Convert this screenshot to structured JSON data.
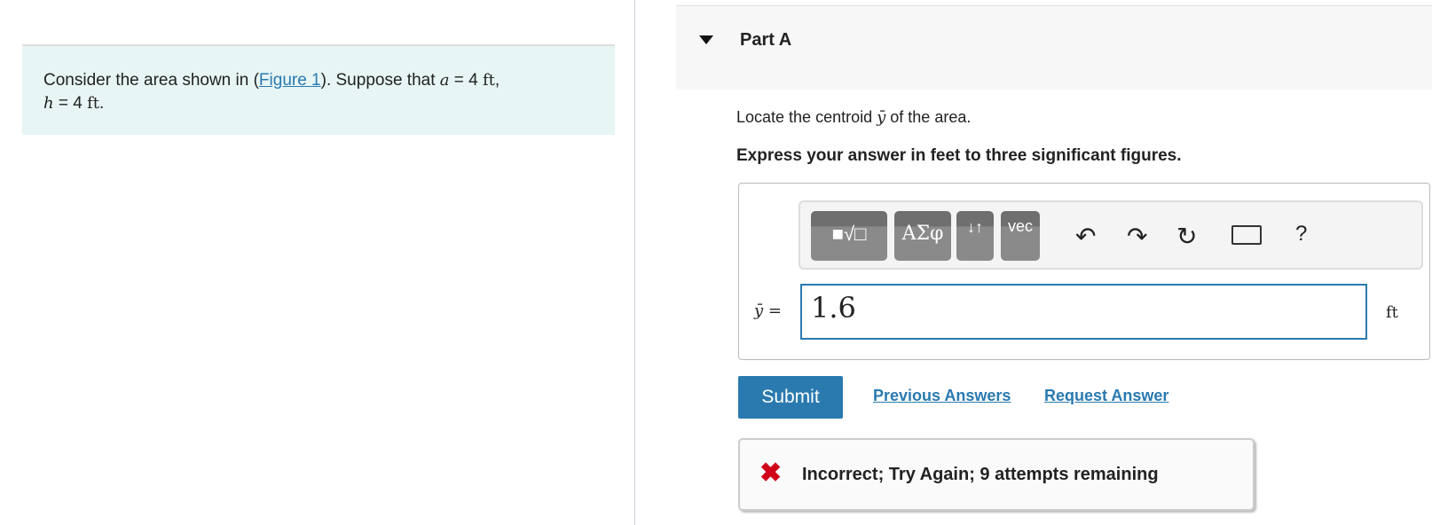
{
  "problem": {
    "pre": "Consider the area shown in (",
    "link": "Figure 1",
    "mid": "). Suppose that ",
    "a_var": "a",
    "a_val": " = 4 ",
    "unit": "ft",
    "comma": ",",
    "h_var": "h",
    "h_val": " = 4 ",
    "end": "."
  },
  "part": {
    "title": "Part A",
    "question_pre": "Locate the centroid ",
    "question_var": "ȳ",
    "question_post": " of the area.",
    "instruction": "Express your answer in feet to three significant figures."
  },
  "toolbar": {
    "templates": "■√□",
    "greek": "ΑΣφ",
    "arrows": "↓↑",
    "vec": "vec",
    "undo": "undo-icon",
    "redo": "redo-icon",
    "reset": "reset-icon",
    "keyboard": "keyboard-icon",
    "help": "?"
  },
  "answer": {
    "label": "ȳ =",
    "value": "1.6",
    "unit": "ft"
  },
  "actions": {
    "submit": "Submit",
    "previous": "Previous Answers",
    "request": "Request Answer"
  },
  "feedback": {
    "icon": "✖",
    "text": "Incorrect; Try Again; 9 attempts remaining",
    "color": "#d0021b"
  },
  "colors": {
    "accent": "#2a7ab0"
  }
}
